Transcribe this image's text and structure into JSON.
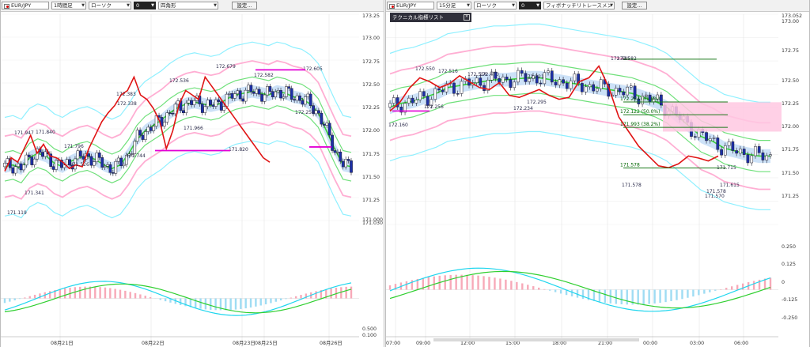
{
  "panels": [
    {
      "toolbar": {
        "pair": "EUR/JPY",
        "timeframe": "1時間足",
        "chart_type": "ローソク",
        "value": "0",
        "draw_tool": "四角形",
        "settings": "設定..."
      },
      "chart_data": {
        "type": "candlestick",
        "price_ylim": [
          171.0,
          173.3
        ],
        "price_ticks": [
          "173.25",
          "173.00",
          "172.75",
          "172.50",
          "172.25",
          "172.00",
          "171.75",
          "171.50",
          "171.25",
          "171.000",
          "171.030"
        ],
        "macd_ylim": [
          -0.25,
          0.25
        ],
        "macd_ticks": [
          "0.250",
          "0.125",
          "0",
          "-0.125",
          "-0.250",
          "0.500",
          "0.100"
        ],
        "x_labels": [
          "08月21日",
          "08月22日",
          "08月23日",
          "08月25日",
          "08月26日"
        ],
        "annotations": [
          "172.679",
          "172.605",
          "172.582",
          "172.536",
          "172.383",
          "172.338",
          "172.254",
          "171.966",
          "171.947",
          "171.840",
          "171.820",
          "171.796",
          "171.744",
          "171.526",
          "171.341",
          "171.119"
        ],
        "horizontal_lines": [
          172.68,
          171.78,
          171.75
        ],
        "series": [
          {
            "values": [
              171.6,
              171.62,
              171.58,
              171.7,
              171.75,
              171.72,
              171.64,
              171.6,
              171.66,
              171.7,
              171.72,
              171.68,
              171.62,
              171.58,
              171.62,
              171.74,
              171.9,
              172.0,
              172.06,
              172.12,
              172.2,
              172.26,
              172.3,
              172.32,
              172.3,
              172.28,
              172.3,
              172.36,
              172.4,
              172.42,
              172.44,
              172.42,
              172.4,
              172.44,
              172.42,
              172.38,
              172.36,
              172.3,
              172.2,
              172.0,
              171.8,
              171.62,
              171.6
            ]
          },
          {
            "values": [
              171.55,
              171.7,
              171.65,
              171.8,
              171.95,
              171.75,
              171.85,
              171.72,
              171.7,
              171.65,
              171.58,
              171.62,
              171.6,
              171.8,
              171.95,
              172.1,
              172.2,
              172.28,
              172.4,
              172.45,
              172.6,
              172.4,
              172.35,
              172.25,
              172.1,
              171.8,
              172.0,
              172.3,
              172.45,
              172.4,
              172.35,
              172.6,
              172.5,
              172.4,
              172.3,
              172.2,
              172.1,
              172.0,
              171.9,
              171.8,
              171.7,
              171.65
            ]
          }
        ]
      }
    },
    {
      "toolbar": {
        "pair": "EUR/JPY",
        "timeframe": "15分足",
        "chart_type": "ローソク",
        "value": "0",
        "draw_tool": "フィボナッチリトレースメント",
        "settings": "設定..."
      },
      "tech_list": "テクニカル指標リスト",
      "chart_data": {
        "type": "candlestick",
        "price_ylim": [
          171.0,
          173.15
        ],
        "price_ticks": [
          "173.052",
          "173.00",
          "172.75",
          "172.50",
          "172.25",
          "172.00",
          "171.75",
          "171.50",
          "171.25",
          "0.250",
          "0.125",
          "0",
          "-0.125",
          "-0.250"
        ],
        "macd_ylim": [
          -0.25,
          0.25
        ],
        "x_labels": [
          "07:00",
          "09:00",
          "12:00",
          "15:00",
          "18:00",
          "21:00",
          "00:00",
          "03:00",
          "06:00"
        ],
        "annotations": [
          "172.685",
          "172.582",
          "172.550",
          "172.516",
          "172.516",
          "172.470",
          "172.321",
          "172.295",
          "172.256",
          "172.234",
          "172.160",
          "171.715",
          "171.615",
          "171.578",
          "171.570",
          "171.578"
        ],
        "fibonacci": [
          {
            "label": "172.253 (61.8%)",
            "price": 172.253
          },
          {
            "label": "172.122 (50.0%)",
            "price": 172.122
          },
          {
            "label": "171.993 (38.2%)",
            "price": 171.993
          },
          {
            "label": "171.578",
            "price": 171.578
          }
        ],
        "series": [
          {
            "values": [
              172.2,
              172.24,
              172.26,
              172.3,
              172.34,
              172.4,
              172.42,
              172.44,
              172.46,
              172.48,
              172.48,
              172.49,
              172.5,
              172.5,
              172.48,
              172.46,
              172.44,
              172.42,
              172.4,
              172.38,
              172.36,
              172.34,
              172.3,
              172.26,
              172.2,
              172.1,
              172.0,
              171.9,
              171.85,
              171.78,
              171.75,
              171.72,
              171.7,
              171.7
            ]
          },
          {
            "values": [
              172.16,
              172.25,
              172.4,
              172.5,
              172.46,
              172.4,
              172.44,
              172.52,
              172.46,
              172.4,
              172.38,
              172.45,
              172.32,
              172.3,
              172.34,
              172.38,
              172.32,
              172.28,
              172.3,
              172.46,
              172.5,
              172.62,
              172.4,
              172.1,
              171.95,
              171.8,
              171.7,
              171.6,
              171.58,
              171.62,
              171.7,
              171.68,
              171.65,
              171.7
            ]
          }
        ]
      }
    }
  ]
}
